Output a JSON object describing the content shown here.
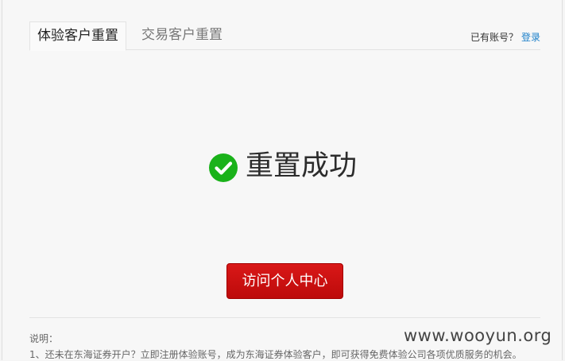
{
  "tabs": {
    "experience_reset": "体验客户重置",
    "trading_reset": "交易客户重置"
  },
  "account": {
    "prompt": "已有账号？",
    "login": "登录"
  },
  "result": {
    "icon": "check-circle-icon",
    "message": "重置成功",
    "color": "#1ab21a"
  },
  "actions": {
    "visit_center": "访问个人中心"
  },
  "notes": {
    "title": "说明：",
    "line1": "1、还未在东海证券开户？立即注册体验账号，成为东海证券体验客户，即可获得免费体验公司各项优质服务的机会。"
  },
  "watermark": "www.wooyun.org",
  "colors": {
    "button": "#c91010",
    "link": "#1b7fc9"
  }
}
